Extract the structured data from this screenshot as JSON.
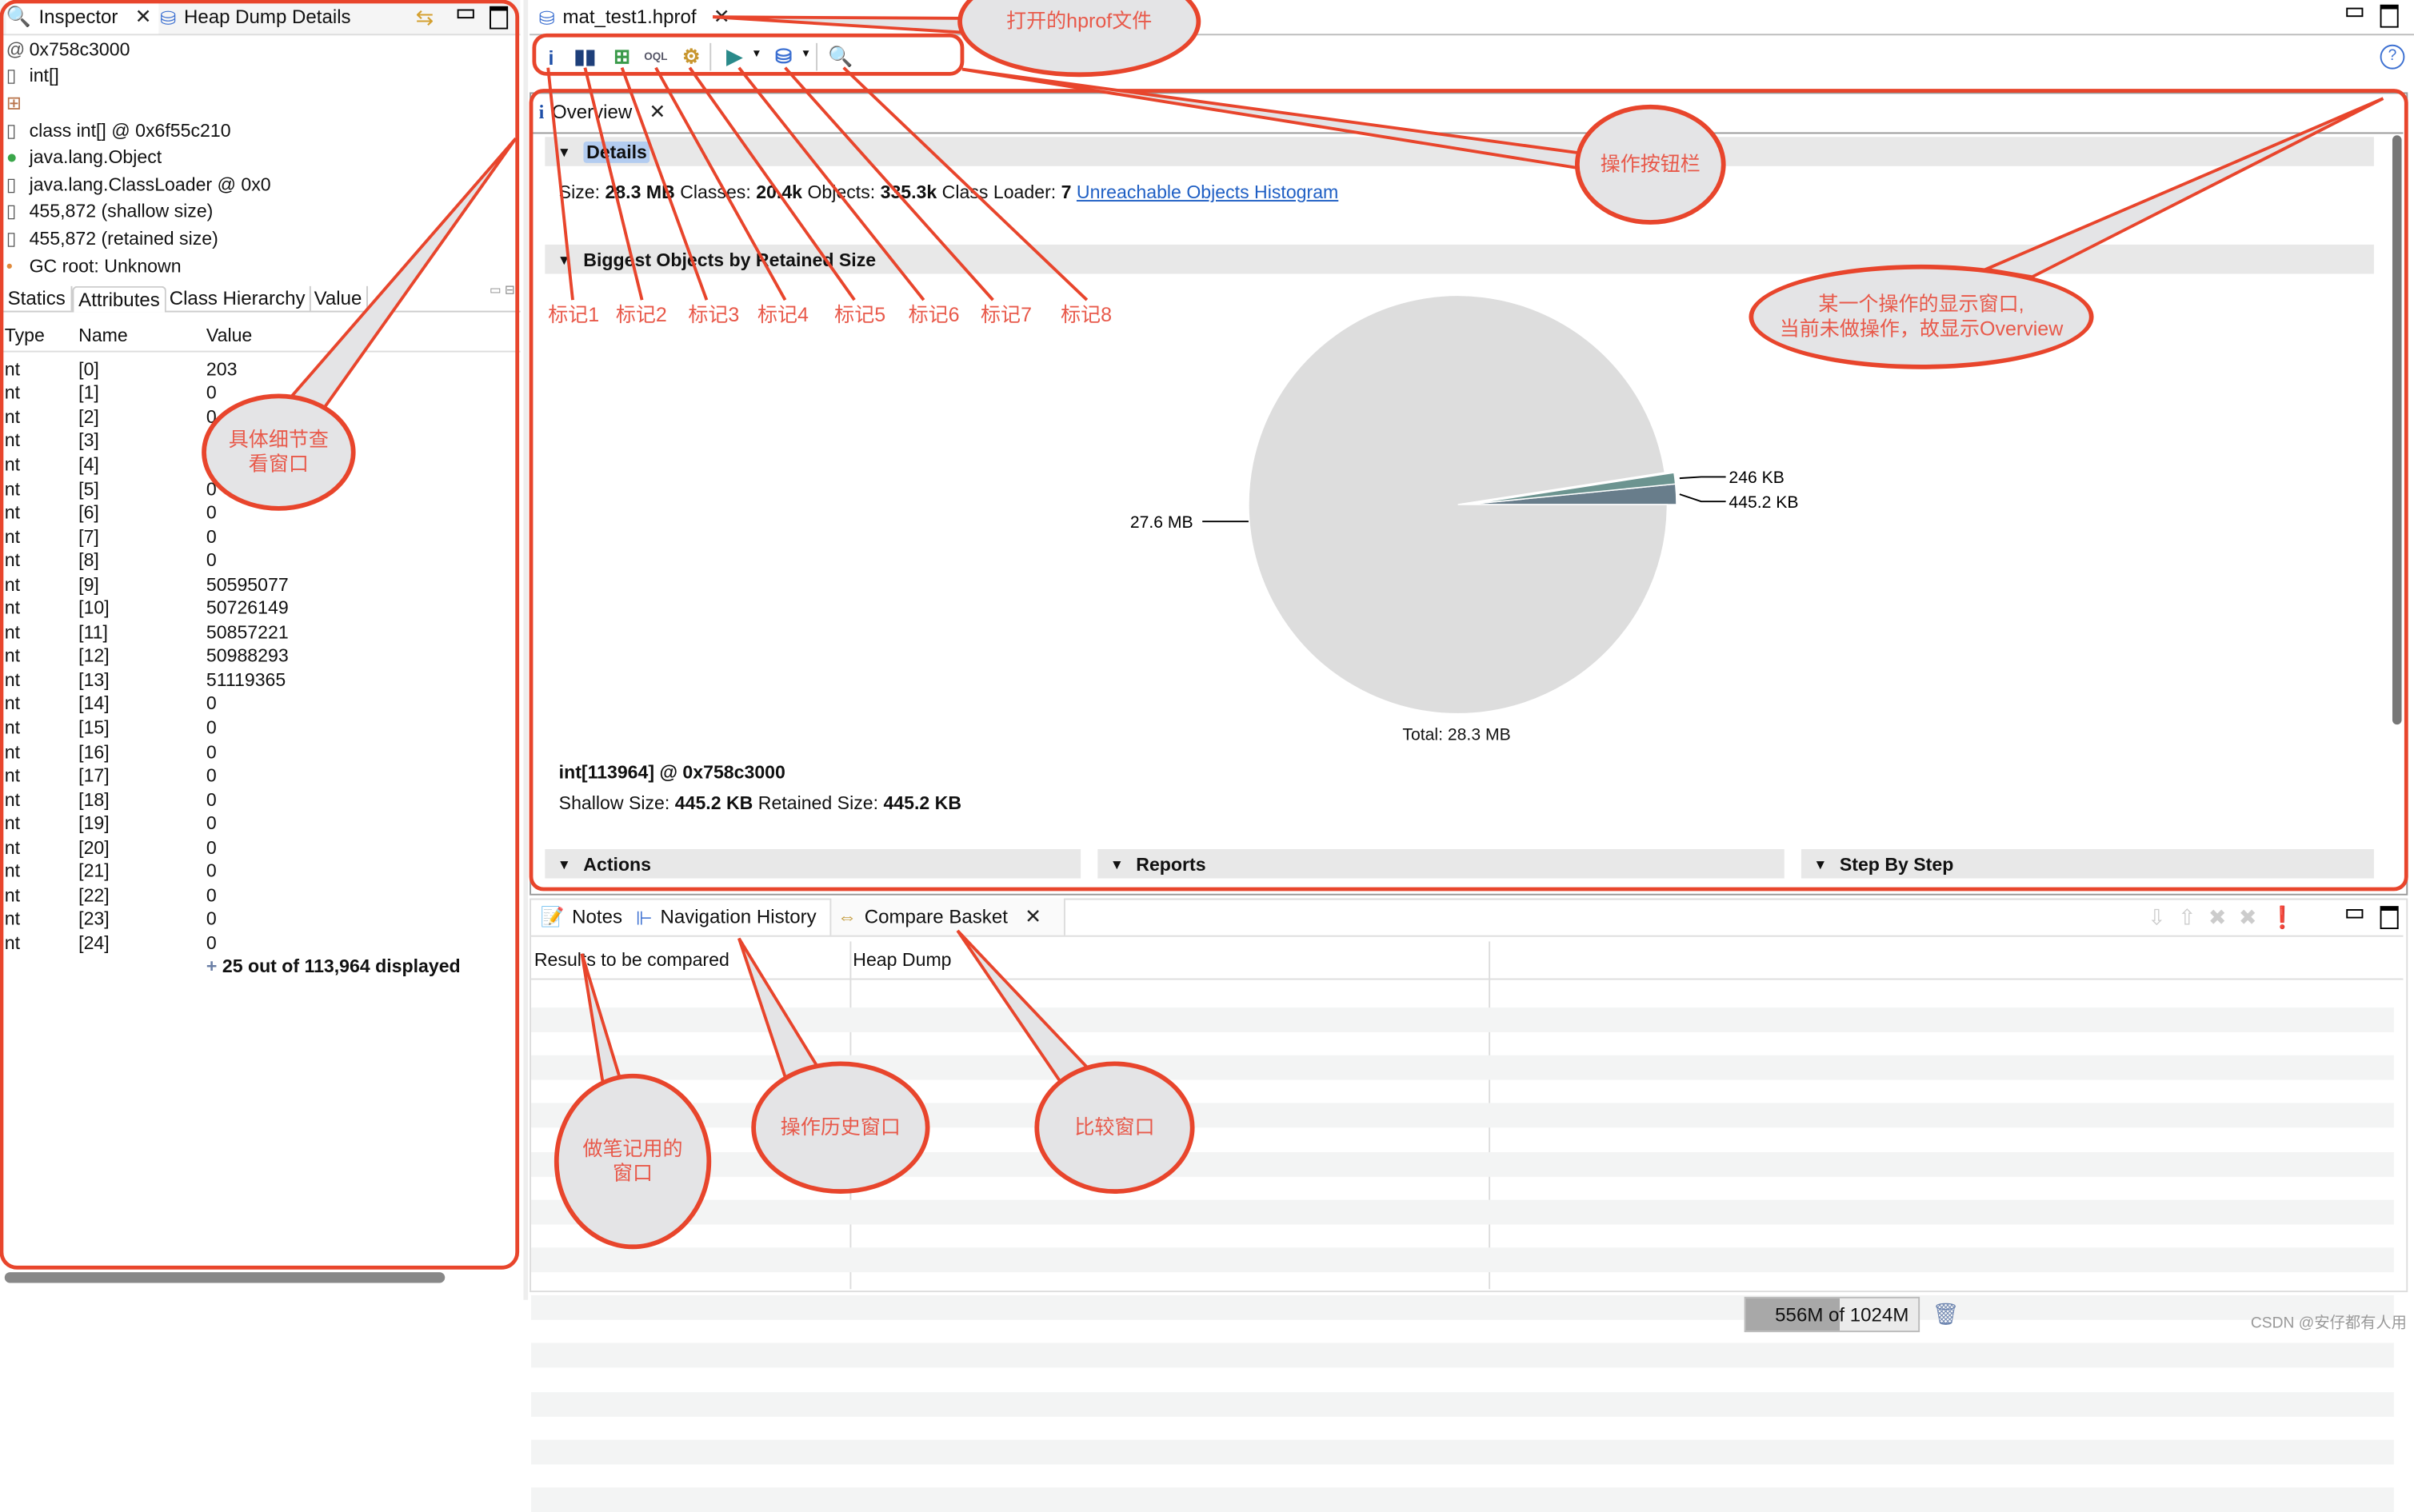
{
  "left_panel": {
    "tabs": [
      {
        "label": "Inspector",
        "icon": "inspector-icon",
        "closable": true
      },
      {
        "label": "Heap Dump Details",
        "icon": "heap-dump-icon",
        "closable": false
      }
    ],
    "properties": [
      {
        "icon": "address-icon",
        "text": "0x758c3000"
      },
      {
        "icon": "array-icon",
        "text": "int[]"
      },
      {
        "icon": "grid-icon",
        "text": ""
      },
      {
        "icon": "class-icon",
        "text": "class int[] @ 0x6f55c210"
      },
      {
        "icon": "superclass-icon",
        "text": "java.lang.Object"
      },
      {
        "icon": "classloader-icon",
        "text": "java.lang.ClassLoader @ 0x0"
      },
      {
        "icon": "size-icon",
        "text": "455,872 (shallow size)"
      },
      {
        "icon": "size-icon",
        "text": "455,872 (retained size)"
      },
      {
        "icon": "gc-root-icon",
        "text": "GC root: Unknown"
      }
    ],
    "sub_tabs": [
      "Statics",
      "Attributes",
      "Class Hierarchy",
      "Value"
    ],
    "active_sub_tab": "Attributes",
    "table": {
      "columns": [
        "Type",
        "Name",
        "Value"
      ],
      "rows": [
        [
          "nt",
          "[0]",
          "203"
        ],
        [
          "nt",
          "[1]",
          "0"
        ],
        [
          "nt",
          "[2]",
          "0"
        ],
        [
          "nt",
          "[3]",
          ""
        ],
        [
          "nt",
          "[4]",
          ""
        ],
        [
          "nt",
          "[5]",
          "0"
        ],
        [
          "nt",
          "[6]",
          "0"
        ],
        [
          "nt",
          "[7]",
          "0"
        ],
        [
          "nt",
          "[8]",
          "0"
        ],
        [
          "nt",
          "[9]",
          "50595077"
        ],
        [
          "nt",
          "[10]",
          "50726149"
        ],
        [
          "nt",
          "[11]",
          "50857221"
        ],
        [
          "nt",
          "[12]",
          "50988293"
        ],
        [
          "nt",
          "[13]",
          "51119365"
        ],
        [
          "nt",
          "[14]",
          "0"
        ],
        [
          "nt",
          "[15]",
          "0"
        ],
        [
          "nt",
          "[16]",
          "0"
        ],
        [
          "nt",
          "[17]",
          "0"
        ],
        [
          "nt",
          "[18]",
          "0"
        ],
        [
          "nt",
          "[19]",
          "0"
        ],
        [
          "nt",
          "[20]",
          "0"
        ],
        [
          "nt",
          "[21]",
          "0"
        ],
        [
          "nt",
          "[22]",
          "0"
        ],
        [
          "nt",
          "[23]",
          "0"
        ],
        [
          "nt",
          "[24]",
          "0"
        ]
      ],
      "footer": "25 out of 113,964 displayed"
    }
  },
  "editor": {
    "file_tab": "mat_test1.hprof",
    "toolbar": [
      {
        "name": "overview-icon",
        "glyph": "i"
      },
      {
        "name": "histogram-icon",
        "glyph": "▮▮"
      },
      {
        "name": "dominator-tree-icon",
        "glyph": "⊞"
      },
      {
        "name": "oql-icon",
        "glyph": "OQL"
      },
      {
        "name": "thread-overview-icon",
        "glyph": "⚙"
      },
      {
        "name": "run-report-icon",
        "glyph": "▶"
      },
      {
        "name": "query-browser-icon",
        "glyph": "⛁"
      },
      {
        "name": "find-object-icon",
        "glyph": "🔍"
      }
    ],
    "overview_tab": "Overview",
    "details": {
      "heading": "Details",
      "size_label": "Size:",
      "size": "28.3 MB",
      "classes_label": "Classes:",
      "classes": "20.4k",
      "objects_label": "Objects:",
      "objects": "335.3k",
      "loader_label": "Class Loader:",
      "loader": "7",
      "link": "Unreachable Objects Histogram"
    },
    "biggest_heading": "Biggest Objects by Retained Size",
    "selected_object": {
      "title": "int[113964] @ 0x758c3000",
      "shallow_label": "Shallow Size:",
      "shallow": "445.2 KB",
      "retained_label": "Retained Size:",
      "retained": "445.2 KB"
    },
    "bottom_sections": [
      "Actions",
      "Reports",
      "Step By Step"
    ]
  },
  "chart_data": {
    "type": "pie",
    "title": "",
    "total_label": "Total: 28.3 MB",
    "slices": [
      {
        "label": "445.2 KB",
        "value": 445.2,
        "color": "#687d8b"
      },
      {
        "label": "246 KB",
        "value": 246,
        "color": "#6c9490"
      },
      {
        "label": "27.6 MB",
        "value": 27626,
        "color": "#dddddd"
      }
    ],
    "unit": "KB"
  },
  "bottom_panel": {
    "tabs": [
      {
        "label": "Notes",
        "icon": "notes-icon"
      },
      {
        "label": "Navigation History",
        "icon": "navigation-history-icon"
      },
      {
        "label": "Compare Basket",
        "icon": "compare-basket-icon",
        "closable": true
      }
    ],
    "columns": [
      "Results to be compared",
      "Heap Dump"
    ]
  },
  "status_bar": {
    "memory": "556M of 1024M",
    "memory_used_fraction": 0.543,
    "watermark": "CSDN @安仔都有人用"
  },
  "annotations": {
    "file": "打开的hprof文件",
    "toolbar": "操作按钮栏",
    "display": [
      "某一个操作的显示窗口,",
      "当前未做操作，故显示Overview"
    ],
    "detail": [
      "具体细节查",
      "看窗口"
    ],
    "notes": [
      "做笔记用的",
      "窗口"
    ],
    "history": "操作历史窗口",
    "compare": "比较窗口",
    "marks": [
      "标记1",
      "标记2",
      "标记3",
      "标记4",
      "标记5",
      "标记6",
      "标记7",
      "标记8"
    ]
  },
  "colors": {
    "annotation": "#e8452c",
    "link": "#1f5fc4"
  }
}
